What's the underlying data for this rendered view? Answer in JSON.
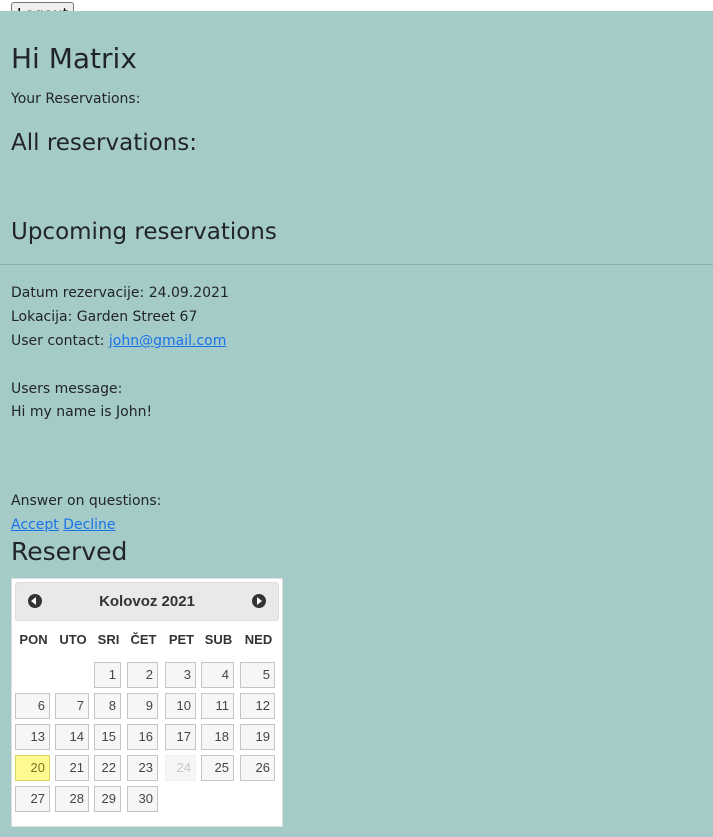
{
  "header": {
    "logout_label": "Logout",
    "greeting": "Hi Matrix"
  },
  "reservations": {
    "your_label": "Your Reservations:",
    "all_heading": "All reservations:",
    "upcoming_heading": "Upcoming reservations"
  },
  "reservation": {
    "date_line": "Datum rezervacije: 24.09.2021",
    "location_line": "Lokacija: Garden Street 67",
    "contact_label": "User contact: ",
    "contact_email": "john@gmail.com",
    "message_label": "Users message:",
    "message_text": "Hi my name is John!",
    "answer_label": "Answer on questions:",
    "accept_label": "Accept",
    "decline_label": "Decline"
  },
  "reserved_heading": "Reserved",
  "calendar": {
    "month_title": "Kolovoz 2021",
    "weekdays": [
      "PON",
      "UTO",
      "SRI",
      "ČET",
      "PET",
      "SUB",
      "NED"
    ],
    "weeks": [
      [
        "",
        "",
        "1",
        "2",
        "3",
        "4",
        "5"
      ],
      [
        "6",
        "7",
        "8",
        "9",
        "10",
        "11",
        "12"
      ],
      [
        "13",
        "14",
        "15",
        "16",
        "17",
        "18",
        "19"
      ],
      [
        "20",
        "21",
        "22",
        "23",
        "24",
        "25",
        "26"
      ],
      [
        "27",
        "28",
        "29",
        "30",
        "",
        "",
        ""
      ]
    ],
    "today": "20",
    "disabled_days": [
      "24"
    ]
  }
}
